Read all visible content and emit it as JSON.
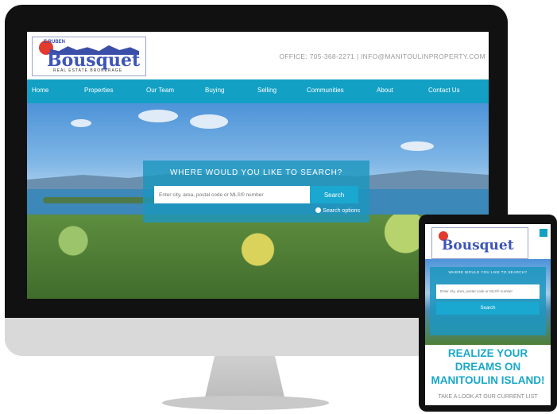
{
  "desktop": {
    "logo": {
      "small_text": "E.RUBEN",
      "name": "Bousquet",
      "sub_text": "REAL ESTATE BROKERAGE"
    },
    "contact": "OFFICE: 705-368-2271  |  INFO@MANITOULINPROPERTY.COM",
    "nav": [
      "Home",
      "Properties",
      "Our Team",
      "Buying",
      "Selling",
      "Communities",
      "About",
      "Contact Us"
    ],
    "search": {
      "title": "WHERE WOULD YOU LIKE TO SEARCH?",
      "placeholder": "Enter city, area, postal code or MLS® number",
      "button": "Search",
      "options": "Search options"
    }
  },
  "tablet": {
    "logo_name": "Bousquet",
    "search": {
      "title": "WHERE WOULD YOU LIKE TO SEARCH?",
      "placeholder": "Enter city, area, postal code or MLS® number",
      "button": "Search"
    },
    "headline": "REALIZE YOUR DREAMS ON MANITOULIN ISLAND!",
    "tagline": "TAKE A LOOK AT OUR CURRENT LIST"
  },
  "colors": {
    "accent": "#12a0c4",
    "headline": "#18a8c8",
    "logo_blue": "#3d55b8",
    "logo_red": "#e23b2e"
  }
}
